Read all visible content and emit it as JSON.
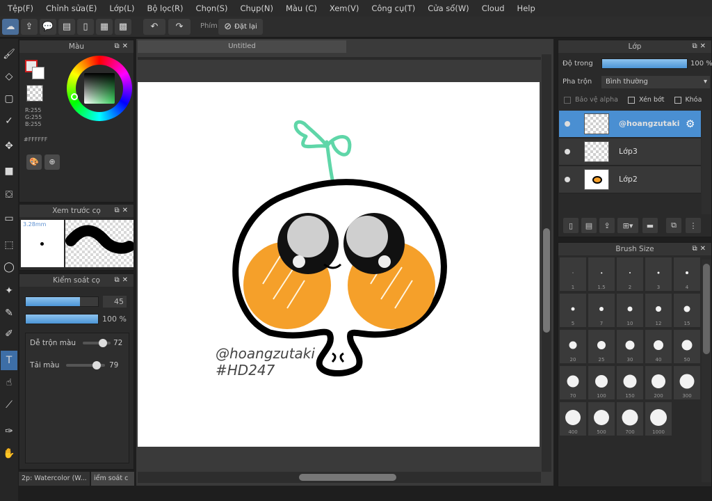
{
  "menu": [
    "Tệp(F)",
    "Chỉnh sửa(E)",
    "Lớp(L)",
    "Bộ lọc(R)",
    "Chọn(S)",
    "Chụp(N)",
    "Màu (C)",
    "Xem(V)",
    "Công cụ(T)",
    "Cửa sổ(W)",
    "Cloud",
    "Help"
  ],
  "toolbar": {
    "snap_label": "Phím",
    "reset_label": "Đặt lại"
  },
  "color_panel": {
    "title": "Màu",
    "r": "R:255",
    "g": "G:255",
    "b": "B:255",
    "hex": "#FFFFFF"
  },
  "brush_preview_panel": {
    "title": "Xem trước cọ",
    "size": "3.28mm"
  },
  "brush_control_panel": {
    "title": "Kiểm soát cọ",
    "size_value": "45",
    "size_fraction": 0.75,
    "opacity_value": "100 %",
    "opacity_fraction": 1.0,
    "blend_label": "Dễ trộn màu",
    "blend_value": "72",
    "blend_fraction": 0.72,
    "reload_label": "Tải màu",
    "reload_value": "79",
    "reload_fraction": 0.79
  },
  "bottom_tabs": {
    "tab1": "2p: Watercolor (W...",
    "tab2": "iểm soát c"
  },
  "canvas": {
    "tab_title": "Untitled",
    "signature": "@hoangzutaki",
    "hashtag": "#HD247"
  },
  "layer_panel": {
    "title": "Lớp",
    "opacity_label": "Độ trong",
    "opacity_value": "100 %",
    "opacity_fraction": 1.0,
    "blend_label": "Pha trộn",
    "blend_value": "Bình thường",
    "protect_alpha": "Bảo vệ alpha",
    "clipping": "Xén bớt",
    "lock": "Khóa",
    "layers": [
      "@hoangzutaki",
      "Lớp3",
      "Lớp2"
    ]
  },
  "brush_size_panel": {
    "title": "Brush Size",
    "sizes": [
      "1",
      "1.5",
      "2",
      "3",
      "4",
      "5",
      "7",
      "10",
      "12",
      "15",
      "20",
      "25",
      "30",
      "40",
      "50",
      "70",
      "100",
      "150",
      "200",
      "300",
      "400",
      "500",
      "700",
      "1000"
    ]
  },
  "colors": {
    "accent": "#4a8fd2",
    "orange": "#f5a02a",
    "sprout": "#5fd6a8"
  }
}
